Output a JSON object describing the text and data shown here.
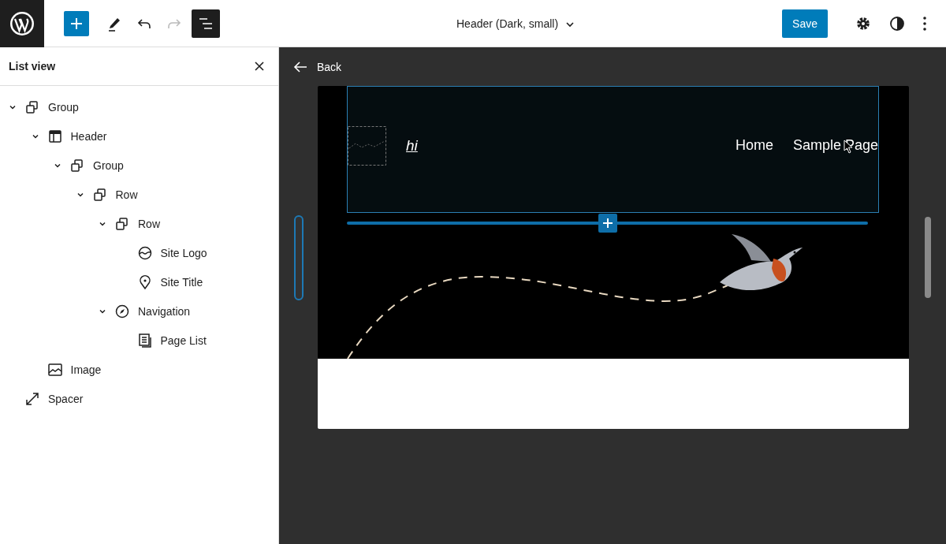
{
  "toolbar": {
    "tools": [
      {
        "kind": "inserter",
        "disabled": false,
        "selected": false
      },
      {
        "kind": "pencil",
        "disabled": false,
        "selected": false
      },
      {
        "kind": "undo",
        "disabled": false,
        "selected": false
      },
      {
        "kind": "redo",
        "disabled": true,
        "selected": false
      },
      {
        "kind": "list-view",
        "disabled": false,
        "selected": true
      }
    ],
    "document_title": "Header (Dark, small)",
    "save": "Save"
  },
  "list_view": {
    "title": "List view",
    "items": [
      {
        "label": "Group",
        "kind": "group",
        "expanded": true,
        "children": [
          {
            "label": "Header",
            "kind": "header",
            "expanded": true,
            "children": [
              {
                "label": "Group",
                "kind": "group",
                "expanded": true,
                "children": [
                  {
                    "label": "Row",
                    "kind": "group",
                    "expanded": true,
                    "children": [
                      {
                        "label": "Row",
                        "kind": "group",
                        "expanded": true,
                        "children": [
                          {
                            "label": "Site Logo",
                            "kind": "logo"
                          },
                          {
                            "label": "Site Title",
                            "kind": "title"
                          }
                        ]
                      },
                      {
                        "label": "Navigation",
                        "kind": "navigation",
                        "expanded": true,
                        "children": [
                          {
                            "label": "Page List",
                            "kind": "page-list"
                          }
                        ]
                      }
                    ]
                  }
                ]
              }
            ]
          },
          {
            "label": "Image",
            "kind": "image"
          }
        ]
      },
      {
        "label": "Spacer",
        "kind": "spacer"
      }
    ]
  },
  "canvas": {
    "back": "Back",
    "site_title": "hi",
    "nav": [
      "Home",
      "Sample Page"
    ]
  }
}
